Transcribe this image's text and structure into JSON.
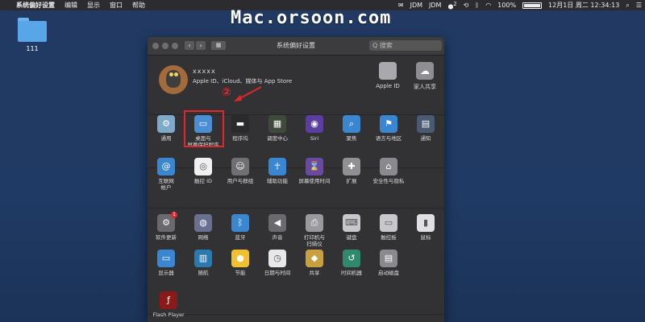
{
  "menubar": {
    "app_name": "系统偏好设置",
    "items": [
      "编辑",
      "显示",
      "窗口",
      "帮助"
    ],
    "status": {
      "jdm1": "JDM",
      "jdm2": "JDM",
      "wechat_count": "2",
      "battery": "100%",
      "datetime": "12月1日 周二  12:34:13"
    }
  },
  "watermark": "Mac.orsoon.com",
  "desktop": {
    "folder_label": "111"
  },
  "window": {
    "title": "系统偏好设置",
    "search_placeholder": "Q 搜索",
    "account": {
      "name": "xxxxx",
      "description": "Apple ID、iCloud、媒体与 App Store",
      "apple_id_label": "Apple ID",
      "family_label": "家人共享"
    },
    "annotation_number": "②",
    "row1": [
      {
        "label": "通用",
        "icon": "general-icon"
      },
      {
        "label": "桌面与\n屏幕保护程序",
        "icon": "desktop-screensaver-icon"
      },
      {
        "label": "程序坞",
        "icon": "dock-icon"
      },
      {
        "label": "调度中心",
        "icon": "mission-control-icon"
      },
      {
        "label": "Siri",
        "icon": "siri-icon"
      },
      {
        "label": "聚焦",
        "icon": "spotlight-icon"
      },
      {
        "label": "语言与地区",
        "icon": "language-region-icon"
      },
      {
        "label": "通知",
        "icon": "notifications-icon"
      }
    ],
    "row2": [
      {
        "label": "互联网\n帐户",
        "icon": "internet-accounts-icon"
      },
      {
        "label": "触控 ID",
        "icon": "touch-id-icon"
      },
      {
        "label": "用户与群组",
        "icon": "users-groups-icon"
      },
      {
        "label": "辅助功能",
        "icon": "accessibility-icon"
      },
      {
        "label": "屏幕使用时间",
        "icon": "screen-time-icon"
      },
      {
        "label": "扩展",
        "icon": "extensions-icon"
      },
      {
        "label": "安全性与隐私",
        "icon": "security-privacy-icon"
      }
    ],
    "row3": [
      {
        "label": "软件更新",
        "icon": "software-update-icon",
        "badge": "1"
      },
      {
        "label": "网络",
        "icon": "network-icon"
      },
      {
        "label": "蓝牙",
        "icon": "bluetooth-icon"
      },
      {
        "label": "声音",
        "icon": "sound-icon"
      },
      {
        "label": "打印机与\n扫描仪",
        "icon": "printers-scanners-icon"
      },
      {
        "label": "键盘",
        "icon": "keyboard-icon"
      },
      {
        "label": "触控板",
        "icon": "trackpad-icon"
      },
      {
        "label": "鼠标",
        "icon": "mouse-icon"
      }
    ],
    "row4": [
      {
        "label": "显示器",
        "icon": "displays-icon"
      },
      {
        "label": "随航",
        "icon": "sidecar-icon"
      },
      {
        "label": "节能",
        "icon": "energy-saver-icon"
      },
      {
        "label": "日期与时间",
        "icon": "date-time-icon"
      },
      {
        "label": "共享",
        "icon": "sharing-icon"
      },
      {
        "label": "时间机器",
        "icon": "time-machine-icon"
      },
      {
        "label": "启动磁盘",
        "icon": "startup-disk-icon"
      }
    ],
    "row5": [
      {
        "label": "Flash Player",
        "icon": "flash-player-icon"
      }
    ]
  }
}
